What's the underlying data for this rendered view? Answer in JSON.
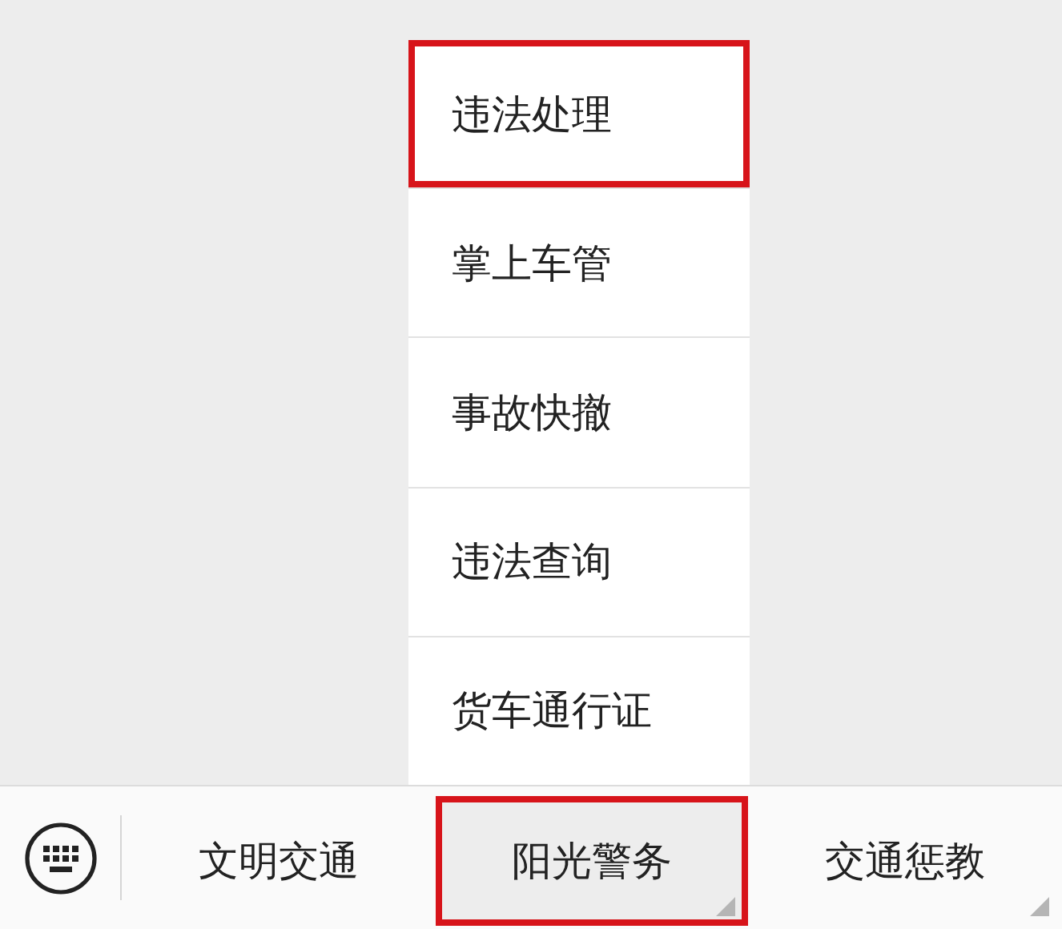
{
  "menu": {
    "items": [
      {
        "label": "违法处理",
        "highlighted": true
      },
      {
        "label": "掌上车管",
        "highlighted": false
      },
      {
        "label": "事故快撤",
        "highlighted": false
      },
      {
        "label": "违法查询",
        "highlighted": false
      },
      {
        "label": "货车通行证",
        "highlighted": false
      }
    ]
  },
  "bottom_bar": {
    "tabs": [
      {
        "label": "文明交通",
        "selected": false,
        "highlighted": false,
        "has_submenu": false
      },
      {
        "label": "阳光警务",
        "selected": true,
        "highlighted": true,
        "has_submenu": true
      },
      {
        "label": "交通惩教",
        "selected": false,
        "highlighted": false,
        "has_submenu": true
      }
    ]
  }
}
